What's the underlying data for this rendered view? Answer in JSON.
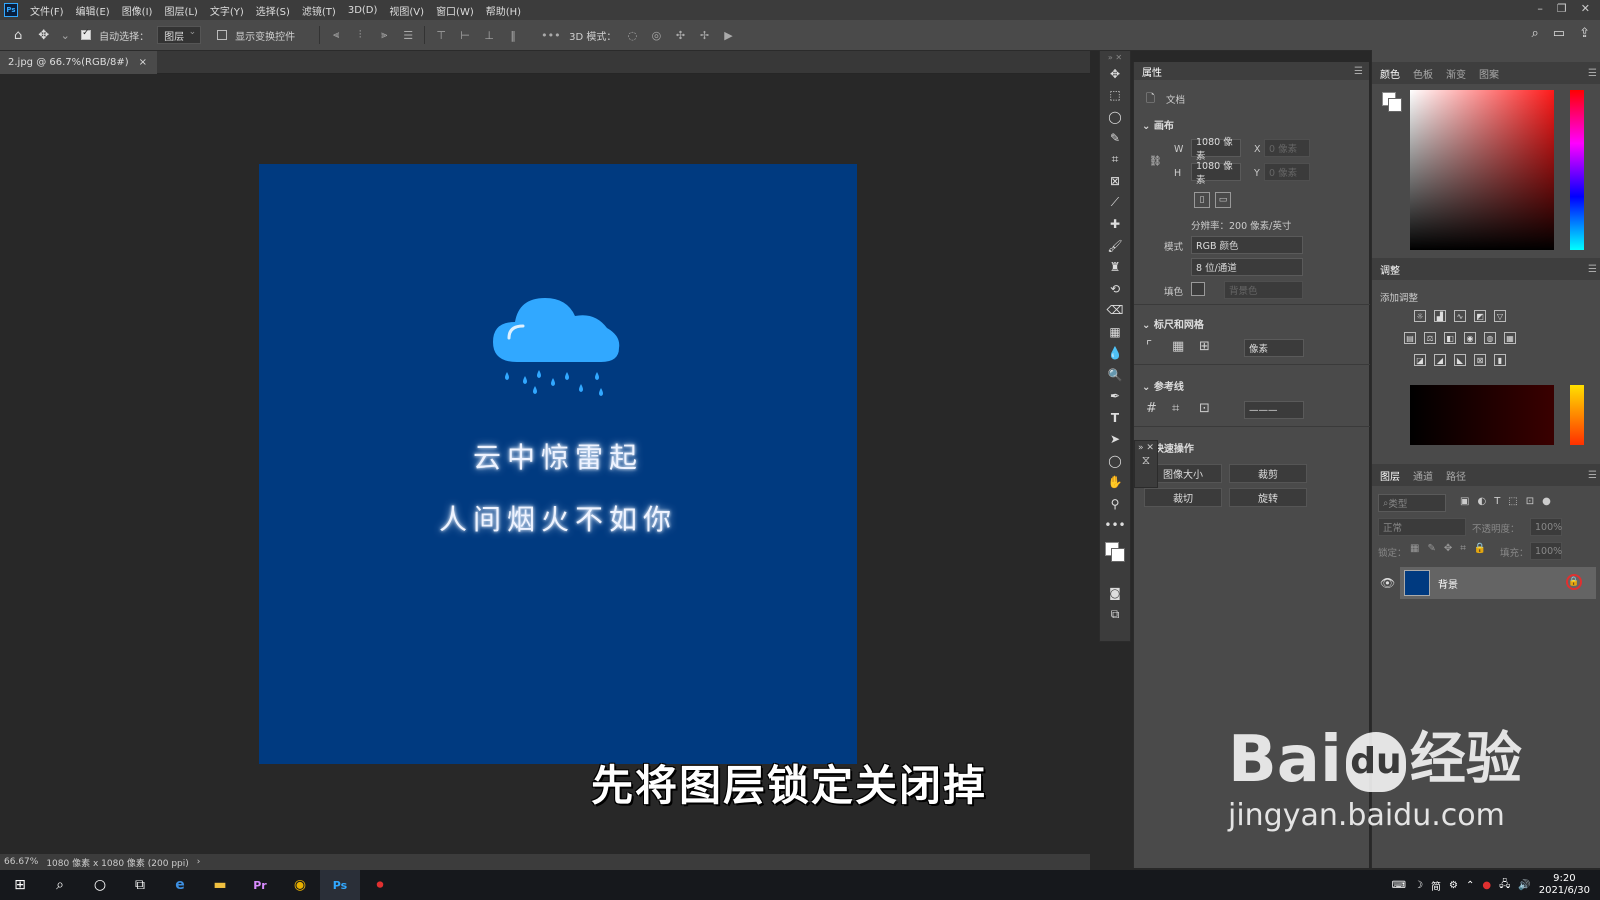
{
  "menubar": {
    "app_icon": "Ps",
    "items": [
      "文件(F)",
      "编辑(E)",
      "图像(I)",
      "图层(L)",
      "文字(Y)",
      "选择(S)",
      "滤镜(T)",
      "3D(D)",
      "视图(V)",
      "窗口(W)",
      "帮助(H)"
    ]
  },
  "options": {
    "auto_select_label": "自动选择：",
    "layer_select": "图层",
    "show_transform_label": "显示变换控件",
    "threed_label": "3D 模式："
  },
  "doc_tab": {
    "title": "2.jpg @ 66.7%(RGB/8#)",
    "close": "×"
  },
  "canvas": {
    "bg": "#003a80",
    "line1": "云中惊雷起",
    "line2": "人间烟火不如你"
  },
  "status": {
    "zoom": "66.67%",
    "info": "1080 像素 x 1080 像素 (200 ppi)",
    "arrow": "›"
  },
  "properties": {
    "tab": "属性",
    "doc_label": "文档",
    "canvas_section": "画布",
    "w_label": "W",
    "w_value": "1080 像素",
    "h_label": "H",
    "h_value": "1080 像素",
    "x_label": "X",
    "x_value": "0 像素",
    "y_label": "Y",
    "y_value": "0 像素",
    "resolution": "分辨率：200 像素/英寸",
    "mode_label": "模式",
    "mode_value": "RGB 颜色",
    "depth_value": "8 位/通道",
    "fill_label": "填色",
    "fill_value": "背景色",
    "rulers_section": "标尺和网格",
    "unit_value": "像素",
    "guides_section": "参考线",
    "quick_section": "快速操作",
    "btn_image_size": "图像大小",
    "btn_crop": "裁剪",
    "btn_trim": "裁切",
    "btn_rotate": "旋转"
  },
  "color_panel": {
    "tabs": [
      "颜色",
      "色板",
      "渐变",
      "图案"
    ]
  },
  "adjust_panel": {
    "tab": "调整",
    "add_label": "添加调整"
  },
  "layers_panel": {
    "tabs": [
      "图层",
      "通道",
      "路径"
    ],
    "search_placeholder": "类型",
    "blend_mode": "正常",
    "opacity_label": "不透明度：",
    "opacity_value": "100%",
    "lock_label": "锁定：",
    "fill_label": "填充：",
    "fill_value": "100%",
    "layer_name": "背景"
  },
  "taskbar": {
    "time": "9:20",
    "date": "2021/6/30",
    "ime": "简"
  },
  "overlay": {
    "subtitle": "先将图层锁定关闭掉",
    "watermark_main": "Bai",
    "watermark_du": "du",
    "watermark_cn": "经验",
    "watermark_url": "jingyan.baidu.com"
  },
  "colors": {
    "accent": "#31a8ff",
    "workspace": "#282828",
    "panel": "#4a4a4a"
  }
}
